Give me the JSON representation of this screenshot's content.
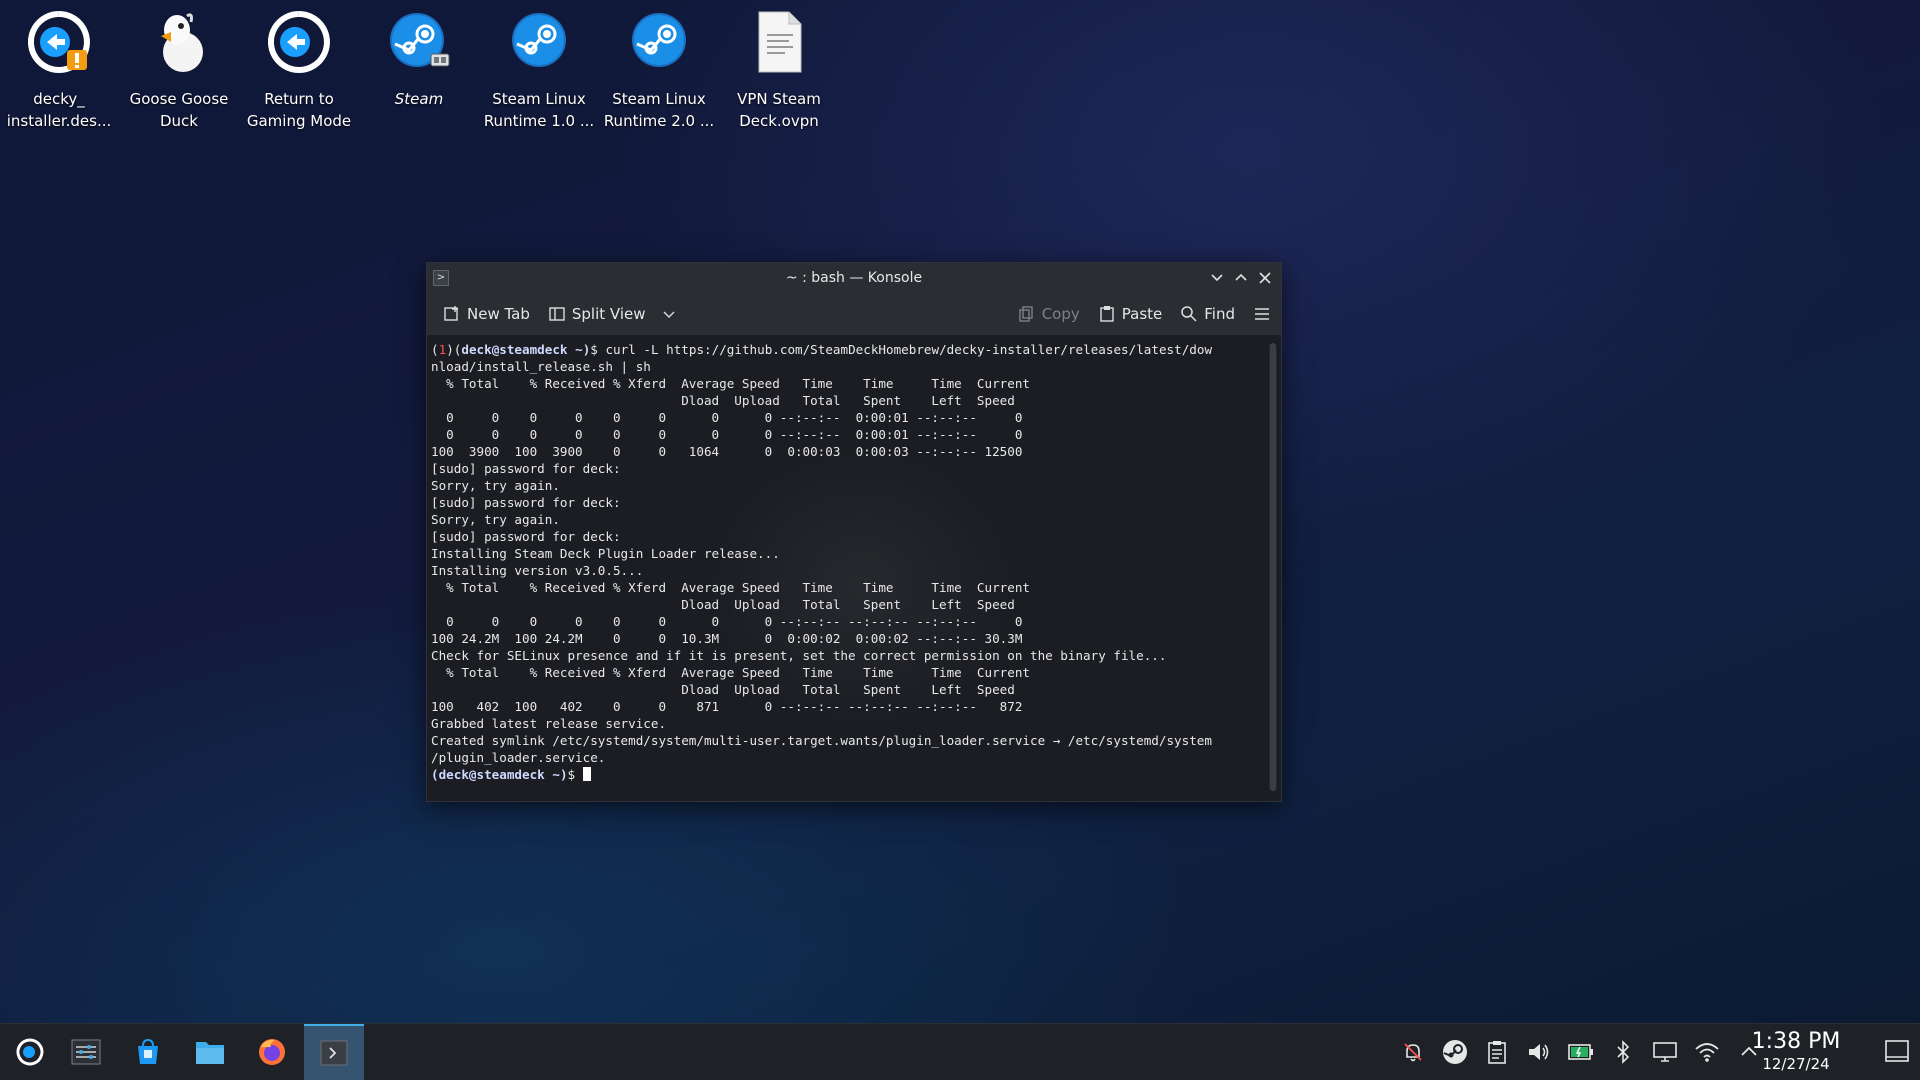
{
  "desktop": {
    "icons": [
      {
        "label_line1": "decky_",
        "label_line2": "installer.des...",
        "icon": "decky-installer-icon"
      },
      {
        "label_line1": "Goose Goose",
        "label_line2": "Duck",
        "icon": "goose-icon"
      },
      {
        "label_line1": "Return to",
        "label_line2": "Gaming Mode",
        "icon": "return-arrow-icon"
      },
      {
        "label_line1": "Steam",
        "label_line2": "",
        "icon": "steam-icon"
      },
      {
        "label_line1": "Steam Linux",
        "label_line2": "Runtime 1.0 ...",
        "icon": "steam-icon"
      },
      {
        "label_line1": "Steam Linux",
        "label_line2": "Runtime 2.0 ...",
        "icon": "steam-icon"
      },
      {
        "label_line1": "VPN Steam",
        "label_line2": "Deck.ovpn",
        "icon": "document-icon"
      }
    ]
  },
  "konsole": {
    "title": "~ : bash — Konsole",
    "toolbar": {
      "new_tab": "New Tab",
      "split_view": "Split View",
      "copy": "Copy",
      "paste": "Paste",
      "find": "Find"
    },
    "first_prompt": {
      "exit_code": "1",
      "user_host": "deck@steamdeck",
      "path": "~",
      "command": "curl -L https://github.com/SteamDeckHomebrew/decky-installer/releases/latest/dow",
      "command_cont": "nload/install_release.sh | sh"
    },
    "output_lines": [
      "  % Total    % Received % Xferd  Average Speed   Time    Time     Time  Current",
      "                                 Dload  Upload   Total   Spent    Left  Speed",
      "  0     0    0     0    0     0      0      0 --:--:--  0:00:01 --:--:--     0",
      "  0     0    0     0    0     0      0      0 --:--:--  0:00:01 --:--:--     0",
      "100  3900  100  3900    0     0   1064      0  0:00:03  0:00:03 --:--:-- 12500",
      "[sudo] password for deck:",
      "Sorry, try again.",
      "[sudo] password for deck:",
      "Sorry, try again.",
      "[sudo] password for deck:",
      "Installing Steam Deck Plugin Loader release...",
      "Installing version v3.0.5...",
      "  % Total    % Received % Xferd  Average Speed   Time    Time     Time  Current",
      "                                 Dload  Upload   Total   Spent    Left  Speed",
      "  0     0    0     0    0     0      0      0 --:--:-- --:--:-- --:--:--     0",
      "100 24.2M  100 24.2M    0     0  10.3M      0  0:00:02  0:00:02 --:--:-- 30.3M",
      "Check for SELinux presence and if it is present, set the correct permission on the binary file...",
      "  % Total    % Received % Xferd  Average Speed   Time    Time     Time  Current",
      "                                 Dload  Upload   Total   Spent    Left  Speed",
      "100   402  100   402    0     0    871      0 --:--:-- --:--:-- --:--:--   872",
      "Grabbed latest release service.",
      "Created symlink /etc/systemd/system/multi-user.target.wants/plugin_loader.service → /etc/systemd/system",
      "/plugin_loader.service."
    ],
    "final_prompt": {
      "user_host": "deck@steamdeck",
      "path": "~"
    }
  },
  "taskbar": {
    "clock_time": "1:38 PM",
    "clock_date": "12/27/24",
    "apps": [
      "application-launcher-icon",
      "system-settings-icon",
      "discover-store-icon",
      "file-manager-icon",
      "firefox-icon",
      "konsole-icon"
    ],
    "tray": [
      "notifications-off-icon",
      "steam-tray-icon",
      "clipboard-icon",
      "volume-icon",
      "battery-icon",
      "bluetooth-icon",
      "display-icon",
      "wifi-icon",
      "tray-expand-icon"
    ]
  },
  "colors": {
    "accent": "#3daee9",
    "steam_blue": "#1a9fff",
    "prompt_error": "#ff5050"
  }
}
